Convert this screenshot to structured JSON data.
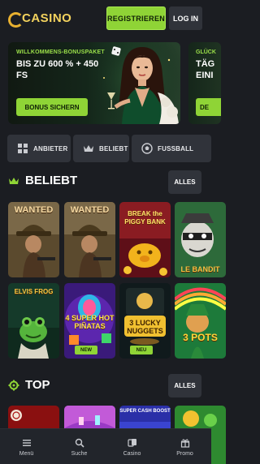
{
  "header": {
    "logo_text": "CASINO",
    "register_label": "REGISTRIEREN",
    "login_label": "LOG IN"
  },
  "banners": [
    {
      "kicker": "WILLKOMMENS-BONUSPAKET",
      "title_line1": "BIS ZU 600 % + 450",
      "title_line2": "FS",
      "button_label": "BONUS SICHERN"
    },
    {
      "kicker": "GLÜCK",
      "title_line1": "TÄG",
      "title_line2": "EINI",
      "button_label": "DE"
    }
  ],
  "filters": [
    {
      "label": "ANBIETER",
      "icon": "grid-icon"
    },
    {
      "label": "BELIEBT",
      "icon": "crown-icon"
    },
    {
      "label": "FUSSBALL",
      "icon": "soccer-ball-icon"
    }
  ],
  "sections": {
    "popular": {
      "title": "BELIEBT",
      "all_label": "ALLES",
      "icon": "crown-icon"
    },
    "top": {
      "title": "TOP",
      "all_label": "ALLES",
      "icon": "gear-icon"
    }
  },
  "games_row1": [
    {
      "caption": "WANTED"
    },
    {
      "caption": "WANTED"
    },
    {
      "caption": "BREAK the PIGGY BANK"
    },
    {
      "caption": "LE BANDIT"
    }
  ],
  "games_row2": [
    {
      "caption": "ELVIS FROG",
      "badge": ""
    },
    {
      "caption": "4 SUPER HOT PIÑATAS",
      "badge": "NEW"
    },
    {
      "caption": "3 LUCKY NUGGETS",
      "badge": "NEU"
    },
    {
      "caption": "3 POTS",
      "badge": ""
    }
  ],
  "games_row3": [
    {
      "caption": ""
    },
    {
      "caption": ""
    },
    {
      "caption": "SUPER CASH BOOST"
    },
    {
      "caption": ""
    }
  ],
  "bottom_nav": [
    {
      "label": "Menü",
      "icon": "menu-icon"
    },
    {
      "label": "Suche",
      "icon": "search-icon"
    },
    {
      "label": "Casino",
      "icon": "cards-icon"
    },
    {
      "label": "Promo",
      "icon": "gift-icon"
    }
  ],
  "colors": {
    "accent": "#8fd436",
    "background": "#1b1d22",
    "surface": "#30333a"
  }
}
